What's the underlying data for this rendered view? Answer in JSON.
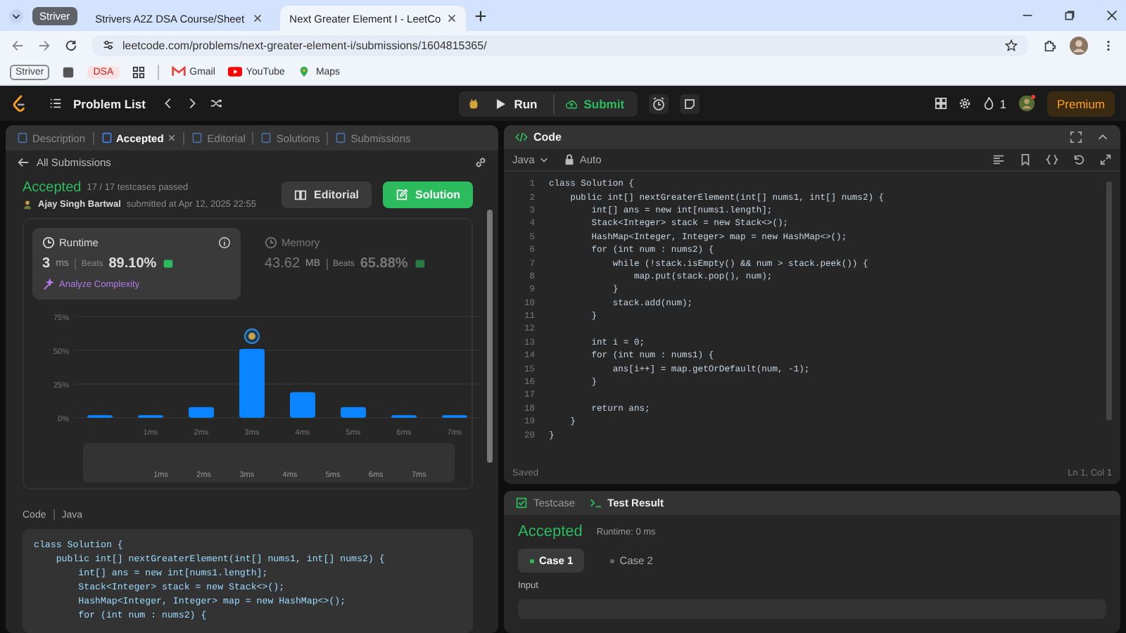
{
  "browser": {
    "tab_group": "Striver",
    "tabs": [
      {
        "title": "Strivers A2Z DSA Course/Sheet",
        "selected": false
      },
      {
        "title": "Next Greater Element I - LeetCo",
        "selected": true
      }
    ],
    "url": "leetcode.com/problems/next-greater-element-i/submissions/1604815365/",
    "bookmarks": [
      {
        "kind": "group",
        "label": "Striver"
      },
      {
        "kind": "square"
      },
      {
        "kind": "folder",
        "label": "DSA"
      },
      {
        "kind": "apps"
      },
      {
        "kind": "mail",
        "label": "Gmail"
      },
      {
        "kind": "video",
        "label": "YouTube"
      },
      {
        "kind": "pin",
        "label": "Maps"
      }
    ]
  },
  "nav": {
    "problem_list": "Problem List",
    "run": "Run",
    "submit": "Submit",
    "streak": "1",
    "premium": "Premium"
  },
  "left": {
    "tabs": [
      {
        "label": "Description",
        "selected": false,
        "closable": false
      },
      {
        "label": "Accepted",
        "selected": true,
        "closable": true
      },
      {
        "label": "Editorial",
        "selected": false,
        "closable": false
      },
      {
        "label": "Solutions",
        "selected": false,
        "closable": false
      },
      {
        "label": "Submissions",
        "selected": false,
        "closable": false
      }
    ],
    "back": "All Submissions",
    "status": "Accepted",
    "testcases": "17 / 17 testcases passed",
    "author": "Ajay Singh Bartwal",
    "submitted": "submitted at Apr 12, 2025 22:55",
    "buttons": [
      {
        "label": "Editorial",
        "kind": "secondary"
      },
      {
        "label": "Solution",
        "kind": "primary"
      }
    ],
    "stats": [
      {
        "title": "Runtime",
        "value": "3",
        "unit": "ms",
        "beats_label": "Beats",
        "beats": "89.10%",
        "selected": true,
        "link": "Analyze Complexity"
      },
      {
        "title": "Memory",
        "value": "43.62",
        "unit": "MB",
        "beats_label": "Beats",
        "beats": "65.88%",
        "selected": false
      }
    ],
    "chart_data": {
      "type": "bar",
      "categories": [
        null,
        "1ms",
        "2ms",
        "3ms",
        "4ms",
        "5ms",
        "6ms",
        "7ms"
      ],
      "values": [
        2,
        2,
        8,
        51,
        19,
        8,
        2,
        2
      ],
      "ylim": [
        0,
        75
      ],
      "yticks": [
        {
          "value": 0,
          "label": "0%"
        },
        {
          "value": 25,
          "label": "25%"
        },
        {
          "value": 50,
          "label": "50%"
        },
        {
          "value": 75,
          "label": "75%"
        }
      ]
    },
    "minimap_labels": [
      "1ms",
      "2ms",
      "3ms",
      "4ms",
      "5ms",
      "6ms",
      "7ms"
    ],
    "code_label": "Code",
    "code_lang": "Java",
    "code": [
      "class Solution {",
      "    public int[] nextGreaterElement(int[] nums1, int[] nums2) {",
      "        int[] ans = new int[nums1.length];",
      "        Stack<Integer> stack = new Stack<>();",
      "        HashMap<Integer, Integer> map = new HashMap<>();",
      "        for (int num : nums2) {"
    ]
  },
  "right": {
    "title": "Code",
    "language": "Java",
    "mode": "Auto",
    "lines": [
      {
        "n": "1",
        "text": "class Solution {"
      },
      {
        "n": "2",
        "text": "    public int[] nextGreaterElement(int[] nums1, int[] nums2) {"
      },
      {
        "n": "3",
        "text": "        int[] ans = new int[nums1.length];"
      },
      {
        "n": "4",
        "text": "        Stack<Integer> stack = new Stack<>();"
      },
      {
        "n": "5",
        "text": "        HashMap<Integer, Integer> map = new HashMap<>();"
      },
      {
        "n": "6",
        "text": "        for (int num : nums2) {"
      },
      {
        "n": "7",
        "text": "            while (!stack.isEmpty() && num > stack.peek()) {"
      },
      {
        "n": "8",
        "text": "                map.put(stack.pop(), num);"
      },
      {
        "n": "9",
        "text": "            }"
      },
      {
        "n": "10",
        "text": "            stack.add(num);"
      },
      {
        "n": "11",
        "text": "        }"
      },
      {
        "n": "12"
      },
      {
        "n": "13",
        "text": "        int i = 0;"
      },
      {
        "n": "14",
        "text": "        for (int num : nums1) {"
      },
      {
        "n": "15",
        "text": "            ans[i++] = map.getOrDefault(num, -1);"
      },
      {
        "n": "16",
        "text": "        }"
      },
      {
        "n": "17"
      },
      {
        "n": "18",
        "text": "        return ans;"
      },
      {
        "n": "19",
        "text": "    }"
      },
      {
        "n": "20",
        "text": "}"
      }
    ],
    "saved": "Saved",
    "cursor": "Ln 1, Col 1",
    "result_tabs": [
      {
        "label": "Testcase",
        "selected": false
      },
      {
        "label": "Test Result",
        "selected": true
      }
    ],
    "result_status": "Accepted",
    "result_runtime": "Runtime: 0 ms",
    "cases": [
      {
        "label": "Case 1",
        "selected": true
      },
      {
        "label": "Case 2",
        "selected": false
      }
    ],
    "input_label": "Input"
  }
}
